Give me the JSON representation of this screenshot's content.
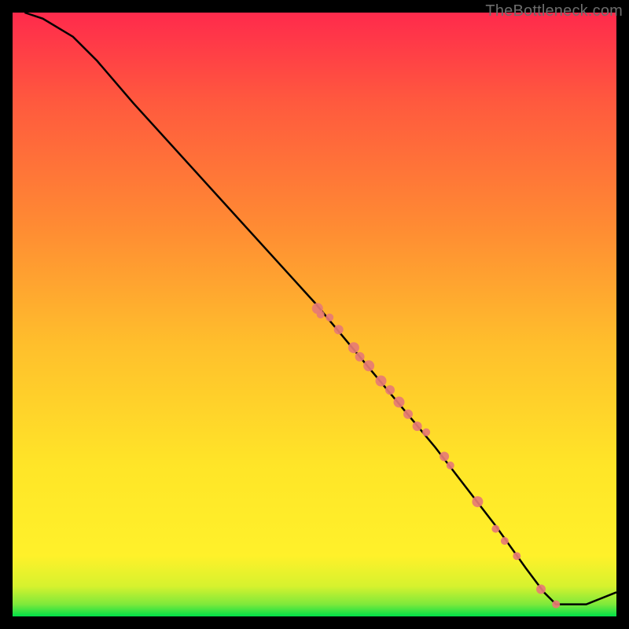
{
  "meta": {
    "watermark": "TheBottleneck.com"
  },
  "chart_data": {
    "type": "line",
    "title": "",
    "xlabel": "",
    "ylabel": "",
    "xlim": [
      0,
      100
    ],
    "ylim": [
      0,
      100
    ],
    "grid": false,
    "legend": false,
    "background_gradient": [
      {
        "stop": 0.0,
        "color": "#00e048"
      },
      {
        "stop": 0.02,
        "color": "#7ee93b"
      },
      {
        "stop": 0.05,
        "color": "#d6f22e"
      },
      {
        "stop": 0.1,
        "color": "#fff12a"
      },
      {
        "stop": 0.25,
        "color": "#ffe528"
      },
      {
        "stop": 0.45,
        "color": "#ffbf2c"
      },
      {
        "stop": 0.65,
        "color": "#ff8a33"
      },
      {
        "stop": 0.85,
        "color": "#ff5a3e"
      },
      {
        "stop": 1.0,
        "color": "#ff2a4c"
      }
    ],
    "series": [
      {
        "name": "bottleneck-curve",
        "stroke": "#000000",
        "x": [
          2,
          5,
          10,
          14,
          20,
          30,
          40,
          50,
          60,
          70,
          80,
          85,
          88,
          90,
          92,
          95,
          100
        ],
        "values": [
          100,
          99,
          96,
          92,
          85,
          74,
          63,
          52,
          40,
          28,
          15,
          8,
          4,
          2,
          2,
          2,
          4
        ]
      }
    ],
    "scatter_markers": {
      "name": "highlight-points",
      "color": "#e77b74",
      "points": [
        {
          "x": 50.5,
          "y": 51.0,
          "r": 7
        },
        {
          "x": 51.0,
          "y": 50.0,
          "r": 5
        },
        {
          "x": 52.5,
          "y": 49.5,
          "r": 5
        },
        {
          "x": 54.0,
          "y": 47.5,
          "r": 6
        },
        {
          "x": 56.5,
          "y": 44.5,
          "r": 7
        },
        {
          "x": 57.5,
          "y": 43.0,
          "r": 6
        },
        {
          "x": 59.0,
          "y": 41.5,
          "r": 7
        },
        {
          "x": 61.0,
          "y": 39.0,
          "r": 7
        },
        {
          "x": 62.5,
          "y": 37.5,
          "r": 6
        },
        {
          "x": 64.0,
          "y": 35.5,
          "r": 7
        },
        {
          "x": 65.5,
          "y": 33.5,
          "r": 6
        },
        {
          "x": 67.0,
          "y": 31.5,
          "r": 6
        },
        {
          "x": 68.5,
          "y": 30.5,
          "r": 5
        },
        {
          "x": 71.5,
          "y": 26.5,
          "r": 6
        },
        {
          "x": 72.5,
          "y": 25.0,
          "r": 5
        },
        {
          "x": 77.0,
          "y": 19.0,
          "r": 7
        },
        {
          "x": 80.0,
          "y": 14.5,
          "r": 5
        },
        {
          "x": 81.5,
          "y": 12.5,
          "r": 5
        },
        {
          "x": 83.5,
          "y": 10.0,
          "r": 5
        },
        {
          "x": 87.5,
          "y": 4.5,
          "r": 6
        },
        {
          "x": 90.0,
          "y": 2.0,
          "r": 5
        }
      ]
    }
  }
}
